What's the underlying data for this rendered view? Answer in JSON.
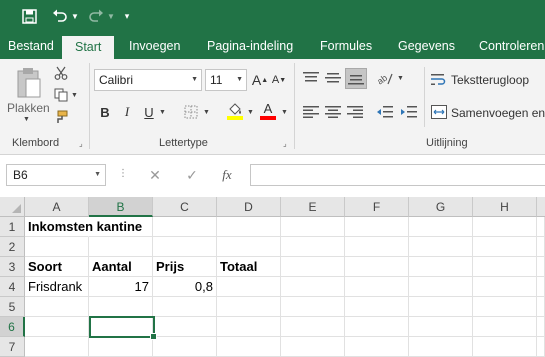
{
  "quick_access": {
    "save_icon": "save-icon",
    "undo_icon": "undo-icon",
    "redo_icon": "redo-icon",
    "more_glyph": "▾"
  },
  "tabs": [
    {
      "label": "Bestand",
      "active": false
    },
    {
      "label": "Start",
      "active": true
    },
    {
      "label": "Invoegen",
      "active": false
    },
    {
      "label": "Pagina-indeling",
      "active": false
    },
    {
      "label": "Formules",
      "active": false
    },
    {
      "label": "Gegevens",
      "active": false
    },
    {
      "label": "Controleren",
      "active": false
    }
  ],
  "ribbon": {
    "clipboard": {
      "paste_label": "Plakken",
      "group_label": "Klembord"
    },
    "font": {
      "name": "Calibri",
      "size": "11",
      "bold": "B",
      "italic": "I",
      "underline": "U",
      "grow": "A",
      "shrink": "A",
      "group_label": "Lettertype"
    },
    "alignment": {
      "wrap_label": "Tekstterugloop",
      "merge_label": "Samenvoegen en",
      "group_label": "Uitlijning"
    }
  },
  "formula_bar": {
    "name_box": "B6",
    "fx": "fx",
    "cancel": "✕",
    "enter": "✓",
    "value": ""
  },
  "sheet": {
    "columns": [
      "A",
      "B",
      "C",
      "D",
      "E",
      "F",
      "G",
      "H"
    ],
    "rows": [
      "1",
      "2",
      "3",
      "4",
      "5",
      "6",
      "7"
    ],
    "selected_cell": "B6",
    "cells": {
      "A1": "Inkomsten kantine",
      "A3": "Soort",
      "B3": "Aantal",
      "C3": "Prijs",
      "D3": "Totaal",
      "A4": "Frisdrank",
      "B4": "17",
      "C4": "0,8"
    }
  },
  "colors": {
    "accent": "#217346",
    "ribbon_bg": "#f3f3f3",
    "font_highlight": "#ffff00",
    "font_color": "#ff0000"
  }
}
